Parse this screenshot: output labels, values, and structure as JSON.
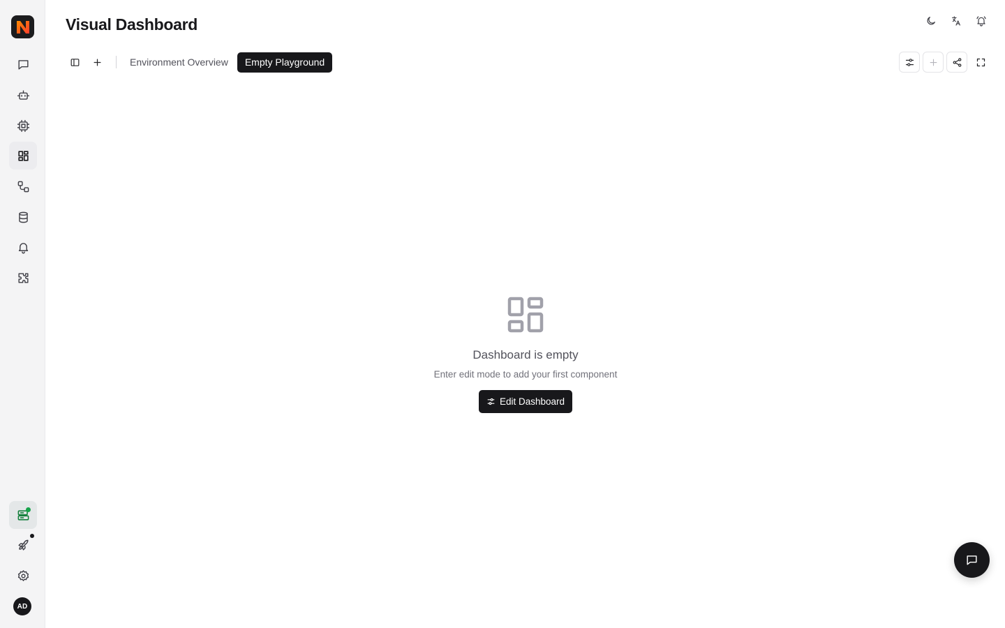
{
  "app": {
    "title": "Visual Dashboard",
    "accent": "#18181b",
    "sidebar_bg": "#f4f4f5",
    "env_color": "#15803d"
  },
  "sidebar": {
    "items": [
      {
        "icon": "chat-icon",
        "active": false
      },
      {
        "icon": "bot-icon",
        "active": false
      },
      {
        "icon": "cpu-icon",
        "active": false
      },
      {
        "icon": "dashboard-icon",
        "active": true
      },
      {
        "icon": "workflow-icon",
        "active": false
      },
      {
        "icon": "database-icon",
        "active": false
      },
      {
        "icon": "bell-icon",
        "active": false
      },
      {
        "icon": "puzzle-icon",
        "active": false
      }
    ],
    "bottom": [
      {
        "icon": "environment-icon"
      },
      {
        "icon": "rocket-icon"
      },
      {
        "icon": "gear-icon"
      }
    ],
    "avatar_initials": "AD"
  },
  "header": {
    "actions": [
      "moon-icon",
      "translate-icon",
      "bell-icon"
    ]
  },
  "tabs": [
    {
      "label": "Environment Overview",
      "active": false
    },
    {
      "label": "Empty Playground",
      "active": true
    }
  ],
  "toolbar": {
    "tools": [
      "edit-sliders-icon",
      "add-icon",
      "share-icon",
      "fullscreen-icon"
    ]
  },
  "empty_state": {
    "title": "Dashboard is empty",
    "subtitle": "Enter edit mode to add your first component",
    "button_label": "Edit Dashboard"
  }
}
